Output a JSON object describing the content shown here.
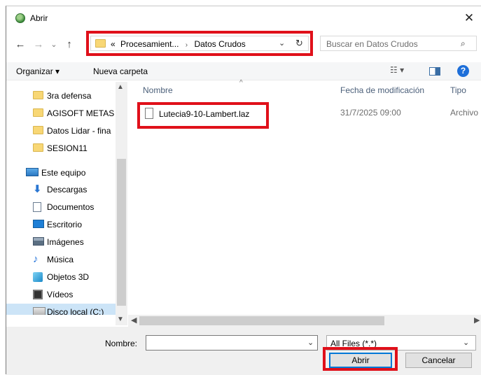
{
  "window": {
    "title": "Abrir",
    "close_glyph": "✕"
  },
  "nav": {
    "back": "←",
    "forward": "→",
    "recent": "⌄",
    "up": "↑"
  },
  "address": {
    "prefix": "«",
    "crumbs": [
      "Procesamient...",
      "Datos Crudos"
    ],
    "separator": "›",
    "dropdown": "⌄",
    "refresh": "↻"
  },
  "search": {
    "placeholder": "Buscar en Datos Crudos",
    "icon": "⌕"
  },
  "toolbar": {
    "organize_label": "Organizar ▾",
    "new_folder_label": "Nueva carpeta",
    "views_label": "☷ ▾",
    "help_label": "?"
  },
  "sidebar": {
    "folders": [
      {
        "label": "3ra defensa",
        "icon": "folder-icon"
      },
      {
        "label": "AGISOFT METAS",
        "icon": "folder-icon"
      },
      {
        "label": "Datos Lidar - fina",
        "icon": "folder-icon"
      },
      {
        "label": "SESION11",
        "icon": "folder-icon"
      }
    ],
    "pc": {
      "label": "Este equipo",
      "icon": "computer-icon"
    },
    "pc_items": [
      {
        "label": "Descargas",
        "icon": "download-icon"
      },
      {
        "label": "Documentos",
        "icon": "document-icon"
      },
      {
        "label": "Escritorio",
        "icon": "desktop-icon"
      },
      {
        "label": "Imágenes",
        "icon": "pictures-icon"
      },
      {
        "label": "Música",
        "icon": "music-icon"
      },
      {
        "label": "Objetos 3D",
        "icon": "objects-3d-icon"
      },
      {
        "label": "Vídeos",
        "icon": "videos-icon"
      },
      {
        "label": "Disco local (C:)",
        "icon": "drive-icon",
        "selected": true
      }
    ]
  },
  "columns": {
    "name": "Nombre",
    "date": "Fecha de modificación",
    "type": "Tipo"
  },
  "files": [
    {
      "name": "Lutecia9-10-Lambert.laz",
      "date": "31/7/2025 09:00",
      "type": "Archivo"
    }
  ],
  "footer": {
    "name_label": "Nombre:",
    "name_value": "",
    "filetype": "All Files (*.*)",
    "open_label": "Abrir",
    "cancel_label": "Cancelar"
  },
  "colors": {
    "highlight_red": "#e0101a",
    "selection_blue": "#cce4f7",
    "accent": "#0078d7"
  }
}
